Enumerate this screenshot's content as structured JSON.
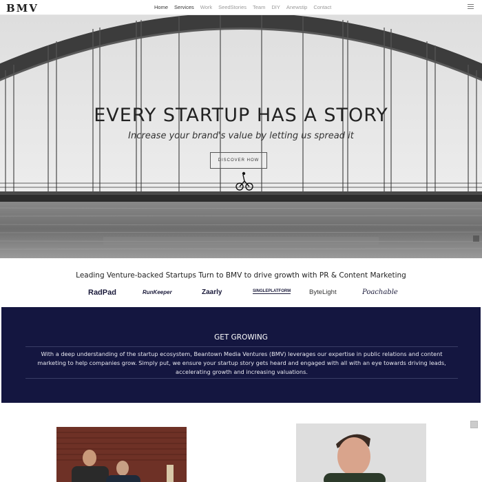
{
  "nav": {
    "logo": "BMV",
    "items": [
      "Home",
      "Services",
      "Work",
      "SeedStories",
      "Team",
      "DIY",
      "Anewstip",
      "Contact"
    ]
  },
  "hero": {
    "title": "EVERY STARTUP HAS A STORY",
    "subtitle": "Increase your brand's value by letting us spread it",
    "button": "DISCOVER HOW"
  },
  "clients": {
    "heading": "Leading Venture-backed Startups Turn to BMV to drive growth with PR & Content Marketing",
    "logos": [
      "RadPad",
      "RunKeeper",
      "Zaarly",
      "SINGLEPLATFORM",
      "ByteLight",
      "Poachable"
    ]
  },
  "growing": {
    "title": "GET GROWING",
    "text": "With a deep understanding of the startup ecosystem, Beantown Media Ventures (BMV) leverages our expertise in public relations and content marketing to help companies grow. Simply put, we ensure your startup story gets heard and engaged with all with an eye towards driving leads, accelerating growth and increasing valuations."
  },
  "colors": {
    "nav_bg": "#ffffff",
    "section_navy": "#141640",
    "text_dark": "#222222"
  },
  "icons": [
    "hamburger-icon",
    "bicycle-rider-icon"
  ]
}
